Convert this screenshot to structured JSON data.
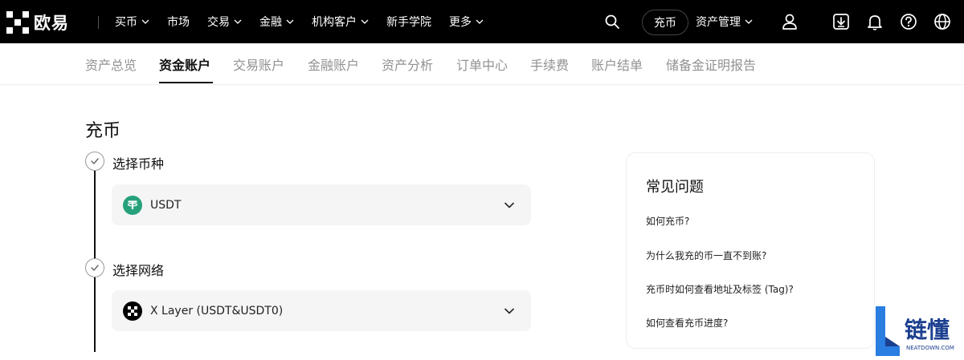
{
  "brand": {
    "logo_text": "欧易"
  },
  "topnav": {
    "menu": [
      {
        "label": "买币",
        "has_dropdown": true
      },
      {
        "label": "市场",
        "has_dropdown": false
      },
      {
        "label": "交易",
        "has_dropdown": true
      },
      {
        "label": "金融",
        "has_dropdown": true
      },
      {
        "label": "机构客户",
        "has_dropdown": true
      },
      {
        "label": "新手学院",
        "has_dropdown": false
      },
      {
        "label": "更多",
        "has_dropdown": true
      }
    ],
    "deposit_label": "充币",
    "asset_management_label": "资产管理",
    "icons": [
      "search-icon",
      "user-icon",
      "download-icon",
      "bell-icon",
      "help-icon",
      "globe-icon"
    ]
  },
  "subtabs": {
    "items": [
      "资产总览",
      "资金账户",
      "交易账户",
      "金融账户",
      "资产分析",
      "订单中心",
      "手续费",
      "账户结单",
      "储备金证明报告"
    ],
    "active": "资金账户"
  },
  "main": {
    "title": "充币",
    "steps": [
      {
        "label": "选择币种",
        "selected_value": "USDT",
        "icon": "usdt-coin-icon"
      },
      {
        "label": "选择网络",
        "selected_value": "X Layer (USDT&USDT0)",
        "icon": "xlayer-network-icon"
      }
    ]
  },
  "faq": {
    "title": "常见问题",
    "items": [
      "如何充币?",
      "为什么我充的币一直不到账?",
      "充币时如何查看地址及标签 (Tag)?",
      "如何查看充币进度?"
    ]
  },
  "watermark": {
    "text": "链懂",
    "subtext": "NEATDOWN.COM"
  },
  "colors": {
    "nav_bg": "#000000",
    "usdt_teal": "#26a17b",
    "inactive_tab": "#929292",
    "select_bg": "#f5f5f5"
  }
}
